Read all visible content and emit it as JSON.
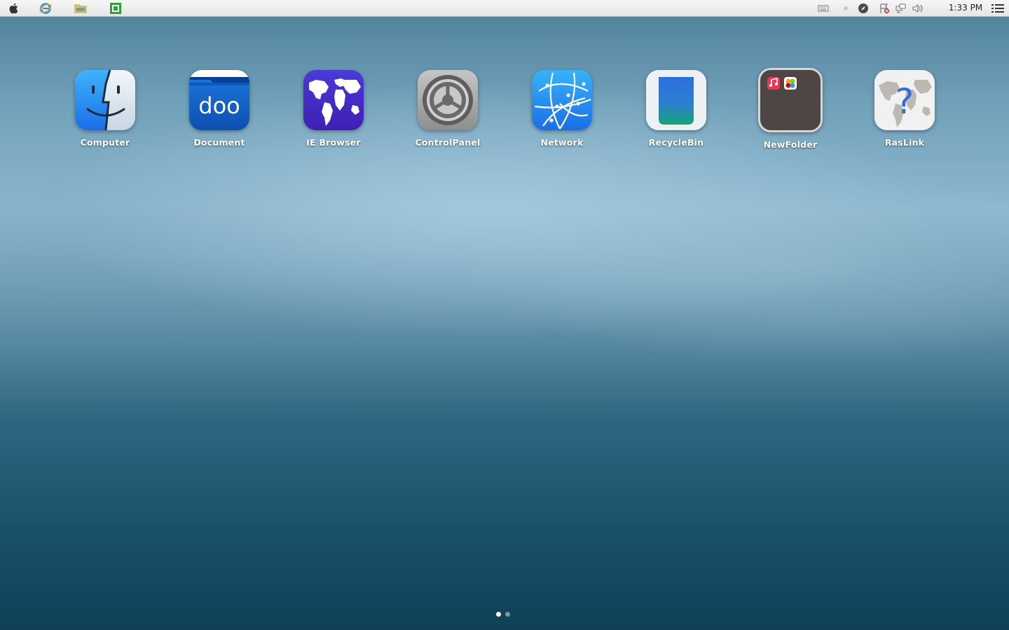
{
  "menubar": {
    "left_icons": [
      "apple-icon",
      "ie-browser-icon",
      "folder-icon",
      "spreadsheet-icon"
    ],
    "tray_icons": [
      "keyboard-icon",
      "status-dot-icon",
      "compass-icon",
      "flag-error-icon",
      "network-monitor-icon",
      "volume-icon"
    ],
    "clock": "1:33 PM",
    "menu_icon": "list-menu-icon"
  },
  "desktop": {
    "apps": [
      {
        "label": "Computer",
        "icon": "finder-icon"
      },
      {
        "label": "Document",
        "icon": "document-folder-icon"
      },
      {
        "label": "IE Browser",
        "icon": "world-map-icon"
      },
      {
        "label": "ControlPanel",
        "icon": "settings-gear-icon"
      },
      {
        "label": "Network",
        "icon": "network-globe-icon"
      },
      {
        "label": "RecycleBin",
        "icon": "trash-bin-icon"
      },
      {
        "label": "NewFolder",
        "icon": "app-folder-icon"
      },
      {
        "label": "RasLink",
        "icon": "help-globe-icon"
      }
    ],
    "page_indicator": {
      "pages": 2,
      "current": 1
    }
  },
  "colors": {
    "menubar": "#eeeeee",
    "label": "#ffffff",
    "accent_blue": "#1a86e8"
  }
}
